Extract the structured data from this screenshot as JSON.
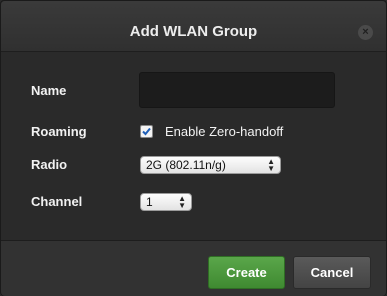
{
  "dialog": {
    "title": "Add WLAN Group",
    "close_symbol": "×"
  },
  "form": {
    "name": {
      "label": "Name",
      "value": ""
    },
    "roaming": {
      "label": "Roaming",
      "checkbox_label": "Enable Zero-handoff",
      "checked": true
    },
    "radio": {
      "label": "Radio",
      "selected": "2G (802.11n/g)"
    },
    "channel": {
      "label": "Channel",
      "selected": "1"
    }
  },
  "footer": {
    "create_label": "Create",
    "cancel_label": "Cancel"
  },
  "colors": {
    "create_button": "#4a9a3c",
    "dialog_background": "#2a2a2a"
  }
}
